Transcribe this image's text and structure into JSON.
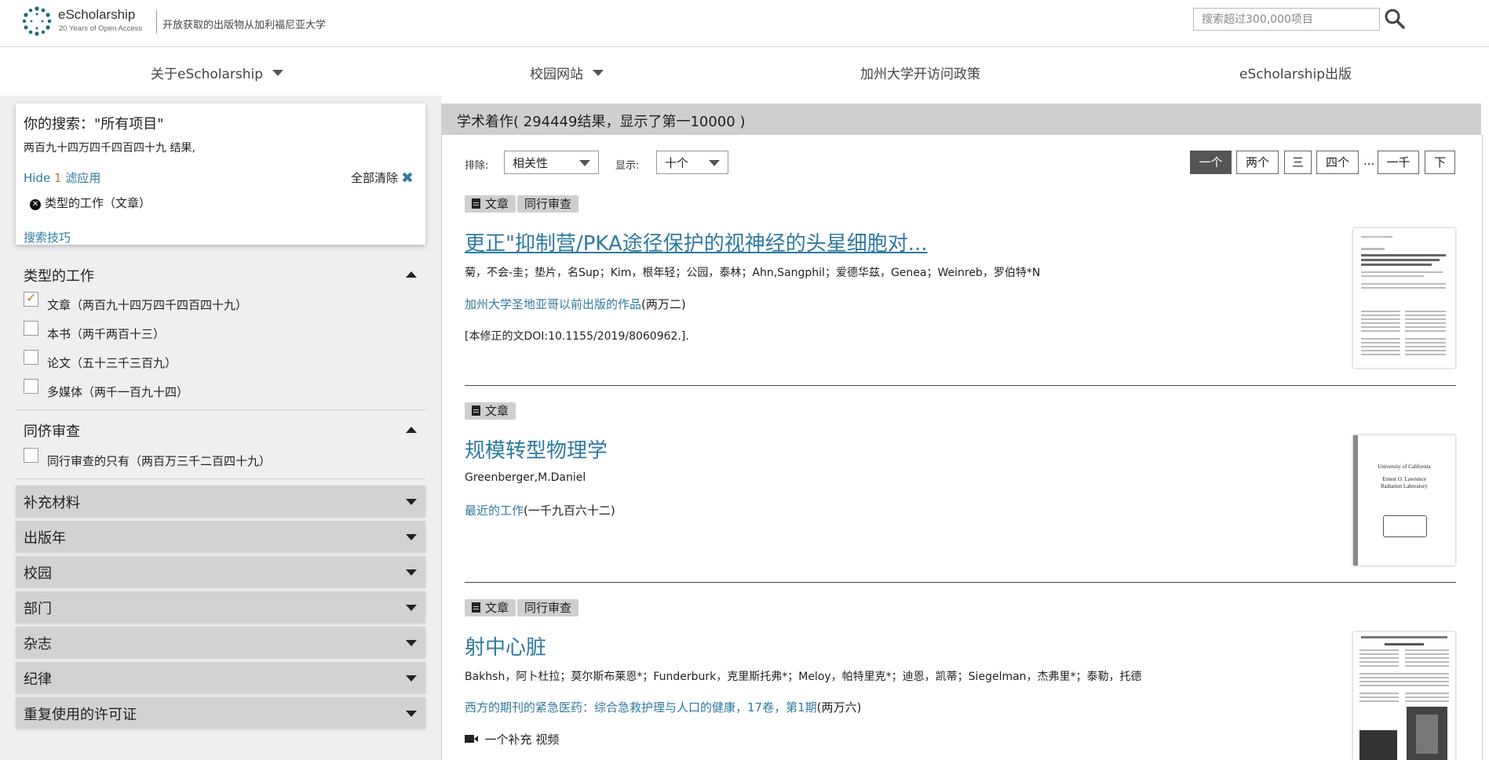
{
  "header": {
    "logo_title": "eScholarship",
    "logo_subtitle": "20 Years of Open Access",
    "tagline": "开放获取的出版物从加利福尼亚大学",
    "search_placeholder": "搜索超过300,000项目"
  },
  "nav": {
    "items": [
      {
        "label": "关于eScholarship",
        "has_dropdown": true
      },
      {
        "label": "校园网站",
        "has_dropdown": true
      },
      {
        "label": "加州大学开访问政策",
        "has_dropdown": false
      },
      {
        "label": "eScholarship出版",
        "has_dropdown": false
      }
    ]
  },
  "search_summary": {
    "title": "你的搜索：\"所有项目\"",
    "count": "两百九十四万四千四百四十九 结果,",
    "hide_prefix": "Hide",
    "hide_count": "1",
    "hide_suffix": "滤应用",
    "clear_all": "全部清除",
    "active_filter": "类型的工作（文章）",
    "tips": "搜索技巧"
  },
  "facets": {
    "work_type": {
      "title": "类型的工作",
      "options": [
        {
          "label": "文章（两百九十四万四千四百四十九）",
          "checked": true
        },
        {
          "label": "本书（两千两百十三）",
          "checked": false
        },
        {
          "label": "论文（五十三千三百九）",
          "checked": false
        },
        {
          "label": "多媒体（两千一百九十四）",
          "checked": false
        }
      ]
    },
    "peer_review": {
      "title": "同侪审查",
      "options": [
        {
          "label": "同行审查的只有（两百万三千二百四十九）",
          "checked": false
        }
      ]
    },
    "collapsed": [
      "补充材料",
      "出版年",
      "校园",
      "部门",
      "杂志",
      "纪律",
      "重复使用的许可证"
    ]
  },
  "results": {
    "header": "学术着作( 294449结果，显示了第一10000 )",
    "sort_label": "排除:",
    "sort_value": "相关性",
    "show_label": "显示:",
    "show_value": "十个",
    "pagination": [
      "一个",
      "两个",
      "三",
      "四个",
      "...",
      "一千",
      "下"
    ],
    "active_page": "一个",
    "items": [
      {
        "tags": [
          "文章",
          "同行审查"
        ],
        "title": "更正\"抑制营/PKA途径保护的视神经的头星细胞对...",
        "authors": "菊，不会-圭；垫片，名Sup；Kim，根年轻；公园，泰林；Ahn,Sangphil；爱德华兹，Genea；Weinreb，罗伯特*N",
        "publication": "加州大学圣地亚哥以前出版的作品",
        "year": "(两万二)",
        "note": "[本修正的文DOI:10.1155/2019/8060962.]."
      },
      {
        "tags": [
          "文章"
        ],
        "title": "规模转型物理学",
        "authors": "Greenberger,M.Daniel",
        "publication": "最近的工作",
        "year": "(一千九百六十二)",
        "note": ""
      },
      {
        "tags": [
          "文章",
          "同行审查"
        ],
        "title": "射中心脏",
        "authors": "Bakhsh，阿卜杜拉；莫尔斯布莱恩*；Funderburk，克里斯托弗*；Meloy，帕特里克*；迪恩，凯蒂；Siegelman，杰弗里*；泰勒，托德",
        "publication": "西方的期刊的紧急医药：综合急救护理与人口的健康，17卷，第1期",
        "year": "(两万六)",
        "supplement": "一个补充 视频"
      }
    ],
    "thumb2_lines": [
      "University of California",
      "Ernest O. Lawrence",
      "Radiation Laboratory"
    ]
  },
  "colors": {
    "link": "#2e7aa0",
    "sidebar_bg": "#efefef",
    "accordion_bg": "#d2d2d2",
    "active_page_bg": "#555555"
  }
}
